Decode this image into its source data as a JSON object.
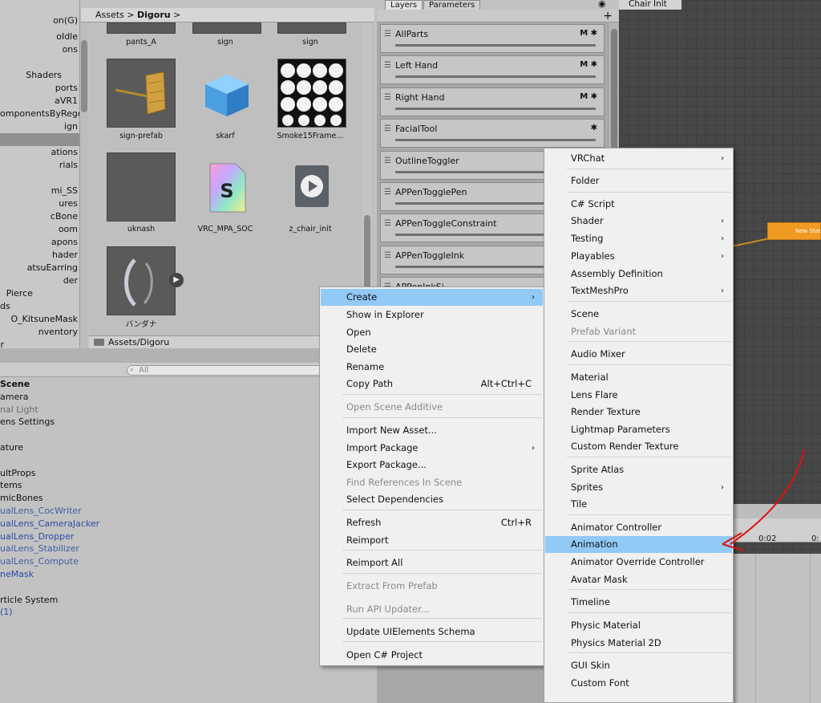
{
  "project_tree": {
    "items": [
      "on(G)",
      "oIdle",
      "ons",
      "",
      "Shaders",
      "ports",
      "aVR1",
      "omponentsByRege",
      "ign",
      "",
      "ations",
      "rials",
      "",
      "mi_SS",
      "ures",
      "cBone",
      "oom",
      "apons",
      "hader",
      "atsuEarring",
      "der",
      "Pierce",
      "ds",
      "O_KitsuneMask",
      "nventory",
      "r"
    ]
  },
  "breadcrumb": {
    "root": "Assets",
    "current": "Digoru",
    "arrow": ">"
  },
  "assets": [
    {
      "label": "pants_A"
    },
    {
      "label": "sign"
    },
    {
      "label": "sign"
    },
    {
      "label": "sign-prefab"
    },
    {
      "label": "skarf"
    },
    {
      "label": "Smoke15Frame..."
    },
    {
      "label": "uknash"
    },
    {
      "label": "VRC_MPA_SOC"
    },
    {
      "label": "z_chair_init"
    },
    {
      "label": "バンダナ"
    }
  ],
  "path_bar": "Assets/Digoru",
  "hierarchy": {
    "search_placeholder": "All",
    "items": [
      "Scene",
      "amera",
      "nal Light",
      "ens Settings",
      "",
      "ature",
      "",
      "ultProps",
      "tems",
      "micBones",
      "ualLens_CocWriter",
      "ualLens_CameraJacker",
      "ualLens_Dropper",
      "ualLens_Stabilizer",
      "ualLens_Compute",
      "neMask",
      "",
      "rticle System",
      "(1)"
    ]
  },
  "animator": {
    "tabs": [
      "Layers",
      "Parameters"
    ],
    "graph_tab": "Chair Init",
    "add_icon": "+",
    "eye_icon": "eye-icon",
    "layers": [
      {
        "name": "AllParts",
        "icons": "M ✱"
      },
      {
        "name": "Left Hand",
        "icons": "M ✱"
      },
      {
        "name": "Right Hand",
        "icons": "M ✱"
      },
      {
        "name": "FacialTool",
        "icons": "✱"
      },
      {
        "name": "OutlineToggler",
        "icons": ""
      },
      {
        "name": "APPenTogglePen",
        "icons": ""
      },
      {
        "name": "APPenToggleConstraint",
        "icons": ""
      },
      {
        "name": "APPenToggleInk",
        "icons": ""
      },
      {
        "name": "APPenInkSi...",
        "icons": ""
      }
    ],
    "state_node": "New State",
    "timeline": {
      "label1": "0:02",
      "label2": "0:"
    }
  },
  "context_menu": {
    "items": [
      {
        "label": "Create",
        "arrow": "›",
        "highlight": true
      },
      {
        "label": "Show in Explorer"
      },
      {
        "label": "Open"
      },
      {
        "label": "Delete"
      },
      {
        "label": "Rename"
      },
      {
        "label": "Copy Path",
        "shortcut": "Alt+Ctrl+C"
      },
      {
        "label": "Open Scene Additive",
        "disabled": true
      },
      {
        "label": "Import New Asset..."
      },
      {
        "label": "Import Package",
        "arrow": "›"
      },
      {
        "label": "Export Package..."
      },
      {
        "label": "Find References In Scene",
        "disabled": true
      },
      {
        "label": "Select Dependencies"
      },
      {
        "label": "Refresh",
        "shortcut": "Ctrl+R"
      },
      {
        "label": "Reimport"
      },
      {
        "label": "Reimport All"
      },
      {
        "label": "Extract From Prefab",
        "disabled": true
      },
      {
        "label": "Run API Updater...",
        "disabled": true
      },
      {
        "label": "Update UIElements Schema"
      },
      {
        "label": "Open C# Project"
      }
    ]
  },
  "create_submenu": {
    "items": [
      {
        "label": "VRChat",
        "arrow": "›"
      },
      {
        "label": "Folder"
      },
      {
        "label": "C# Script"
      },
      {
        "label": "Shader",
        "arrow": "›"
      },
      {
        "label": "Testing",
        "arrow": "›"
      },
      {
        "label": "Playables",
        "arrow": "›"
      },
      {
        "label": "Assembly Definition"
      },
      {
        "label": "TextMeshPro",
        "arrow": "›"
      },
      {
        "label": "Scene"
      },
      {
        "label": "Prefab Variant",
        "disabled": true
      },
      {
        "label": "Audio Mixer"
      },
      {
        "label": "Material"
      },
      {
        "label": "Lens Flare"
      },
      {
        "label": "Render Texture"
      },
      {
        "label": "Lightmap Parameters"
      },
      {
        "label": "Custom Render Texture"
      },
      {
        "label": "Sprite Atlas"
      },
      {
        "label": "Sprites",
        "arrow": "›"
      },
      {
        "label": "Tile"
      },
      {
        "label": "Animator Controller"
      },
      {
        "label": "Animation",
        "highlight": true
      },
      {
        "label": "Animator Override Controller"
      },
      {
        "label": "Avatar Mask"
      },
      {
        "label": "Timeline"
      },
      {
        "label": "Physic Material"
      },
      {
        "label": "Physics Material 2D"
      },
      {
        "label": "GUI Skin"
      },
      {
        "label": "Custom Font"
      }
    ]
  },
  "colors": {
    "menu_highlight": "#91c9f7",
    "state_node": "#f19a22",
    "annotation": "#e01010"
  }
}
